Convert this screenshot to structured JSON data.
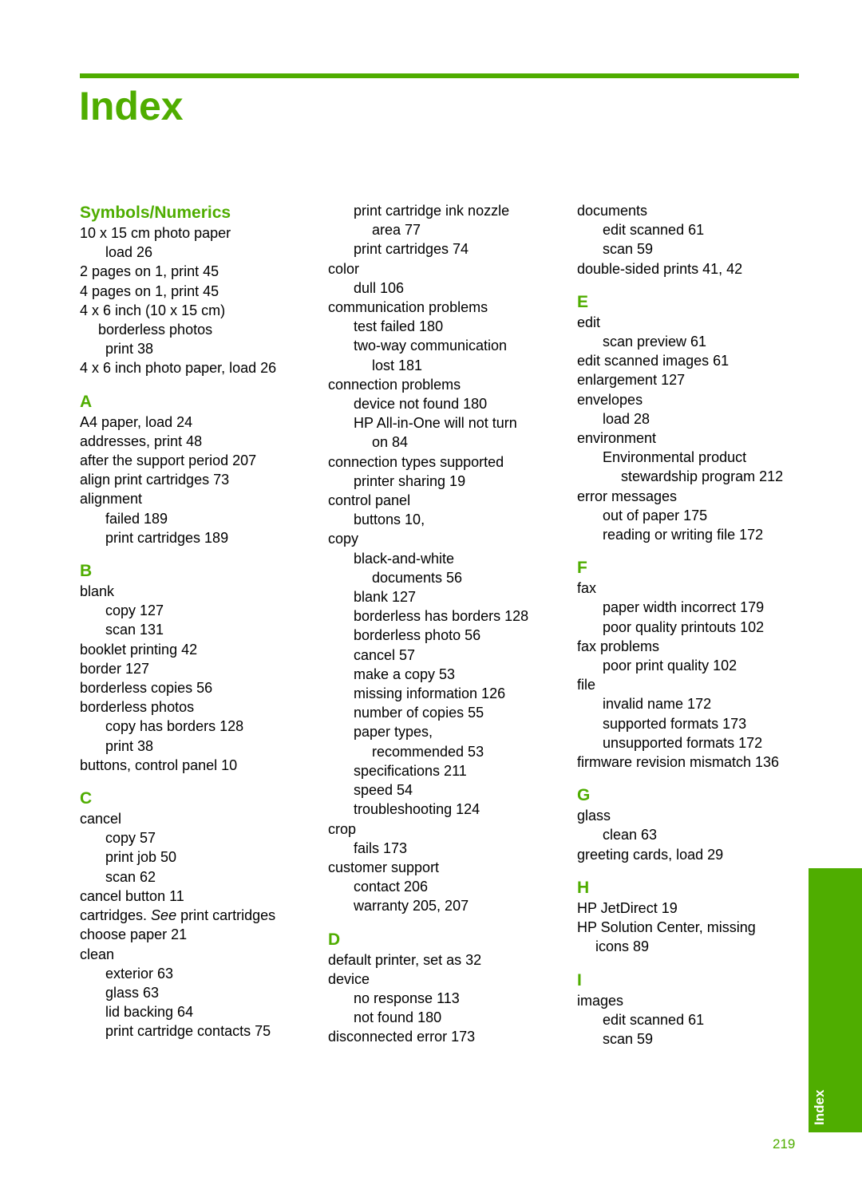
{
  "page": {
    "title": "Index",
    "side_tab_label": "Index",
    "page_number": "219",
    "accent_color": "#4fad00"
  },
  "columns": [
    {
      "sections": [
        {
          "heading": "Symbols/Numerics",
          "entries": [
            {
              "level": 0,
              "text": "10 x 15 cm photo paper"
            },
            {
              "level": 1,
              "text": "load 26"
            },
            {
              "level": 0,
              "text": "2 pages on 1, print 45"
            },
            {
              "level": 0,
              "text": "4 pages on 1, print 45"
            },
            {
              "level": 0,
              "text": "4 x 6 inch (10 x 15 cm)"
            },
            {
              "level": "wrap0",
              "text": "borderless photos"
            },
            {
              "level": 1,
              "text": "print 38"
            },
            {
              "level": 0,
              "text": "4 x 6 inch photo paper, load 26"
            }
          ]
        },
        {
          "heading": "A",
          "entries": [
            {
              "level": 0,
              "text": "A4 paper, load 24"
            },
            {
              "level": 0,
              "text": "addresses, print 48"
            },
            {
              "level": 0,
              "text": "after the support period 207"
            },
            {
              "level": 0,
              "text": "align print cartridges 73"
            },
            {
              "level": 0,
              "text": "alignment"
            },
            {
              "level": 1,
              "text": "failed 189"
            },
            {
              "level": 1,
              "text": "print cartridges 189"
            }
          ]
        },
        {
          "heading": "B",
          "entries": [
            {
              "level": 0,
              "text": "blank"
            },
            {
              "level": 1,
              "text": "copy 127"
            },
            {
              "level": 1,
              "text": "scan 131"
            },
            {
              "level": 0,
              "text": "booklet printing 42"
            },
            {
              "level": 0,
              "text": "border 127"
            },
            {
              "level": 0,
              "text": "borderless copies 56"
            },
            {
              "level": 0,
              "text": "borderless photos"
            },
            {
              "level": 1,
              "text": "copy has borders 128"
            },
            {
              "level": 1,
              "text": "print 38"
            },
            {
              "level": 0,
              "text": "buttons, control panel 10"
            }
          ]
        },
        {
          "heading": "C",
          "entries": [
            {
              "level": 0,
              "text": "cancel"
            },
            {
              "level": 1,
              "text": "copy 57"
            },
            {
              "level": 1,
              "text": "print job 50"
            },
            {
              "level": 1,
              "text": "scan 62"
            },
            {
              "level": 0,
              "text": "cancel button 11"
            },
            {
              "level": 0,
              "text": "cartridges. ",
              "see": "See",
              "see_target": " print cartridges"
            },
            {
              "level": 0,
              "text": "choose paper 21"
            },
            {
              "level": 0,
              "text": "clean"
            },
            {
              "level": 1,
              "text": "exterior 63"
            },
            {
              "level": 1,
              "text": "glass 63"
            },
            {
              "level": 1,
              "text": "lid backing 64"
            },
            {
              "level": 1,
              "text": "print cartridge contacts 75"
            }
          ]
        }
      ]
    },
    {
      "sections": [
        {
          "heading": "",
          "entries": [
            {
              "level": 1,
              "text": "print cartridge ink nozzle"
            },
            {
              "level": 2,
              "text": "area 77"
            },
            {
              "level": 1,
              "text": "print cartridges 74"
            },
            {
              "level": 0,
              "text": "color"
            },
            {
              "level": 1,
              "text": "dull 106"
            },
            {
              "level": 0,
              "text": "communication problems"
            },
            {
              "level": 1,
              "text": "test failed 180"
            },
            {
              "level": 1,
              "text": "two-way communication"
            },
            {
              "level": 2,
              "text": "lost 181"
            },
            {
              "level": 0,
              "text": "connection problems"
            },
            {
              "level": 1,
              "text": "device not found 180"
            },
            {
              "level": 1,
              "text": "HP All-in-One will not turn"
            },
            {
              "level": 2,
              "text": "on 84"
            },
            {
              "level": 0,
              "text": "connection types supported"
            },
            {
              "level": 1,
              "text": "printer sharing 19"
            },
            {
              "level": 0,
              "text": "control panel"
            },
            {
              "level": 1,
              "text": "buttons 10,"
            },
            {
              "level": 0,
              "text": "copy"
            },
            {
              "level": 1,
              "text": "black-and-white"
            },
            {
              "level": 2,
              "text": "documents 56"
            },
            {
              "level": 1,
              "text": "blank 127"
            },
            {
              "level": 1,
              "text": "borderless has borders 128"
            },
            {
              "level": 1,
              "text": "borderless photo 56"
            },
            {
              "level": 1,
              "text": "cancel 57"
            },
            {
              "level": 1,
              "text": "make a copy 53"
            },
            {
              "level": 1,
              "text": "missing information 126"
            },
            {
              "level": 1,
              "text": "number of copies 55"
            },
            {
              "level": 1,
              "text": "paper types,"
            },
            {
              "level": 2,
              "text": "recommended 53"
            },
            {
              "level": 1,
              "text": "specifications 211"
            },
            {
              "level": 1,
              "text": "speed 54"
            },
            {
              "level": 1,
              "text": "troubleshooting 124"
            },
            {
              "level": 0,
              "text": "crop"
            },
            {
              "level": 1,
              "text": "fails 173"
            },
            {
              "level": 0,
              "text": "customer support"
            },
            {
              "level": 1,
              "text": "contact 206"
            },
            {
              "level": 1,
              "text": "warranty 205, 207"
            }
          ]
        },
        {
          "heading": "D",
          "entries": [
            {
              "level": 0,
              "text": "default printer, set as 32"
            },
            {
              "level": 0,
              "text": "device"
            },
            {
              "level": 1,
              "text": "no response 113"
            },
            {
              "level": 1,
              "text": "not found 180"
            },
            {
              "level": 0,
              "text": "disconnected error 173"
            }
          ]
        }
      ]
    },
    {
      "sections": [
        {
          "heading": "",
          "entries": [
            {
              "level": 0,
              "text": "documents"
            },
            {
              "level": 1,
              "text": "edit scanned 61"
            },
            {
              "level": 1,
              "text": "scan 59"
            },
            {
              "level": 0,
              "text": "double-sided prints 41, 42"
            }
          ]
        },
        {
          "heading": "E",
          "entries": [
            {
              "level": 0,
              "text": "edit"
            },
            {
              "level": 1,
              "text": "scan preview 61"
            },
            {
              "level": 0,
              "text": "edit scanned images 61"
            },
            {
              "level": 0,
              "text": "enlargement 127"
            },
            {
              "level": 0,
              "text": "envelopes"
            },
            {
              "level": 1,
              "text": "load 28"
            },
            {
              "level": 0,
              "text": "environment"
            },
            {
              "level": 1,
              "text": "Environmental product"
            },
            {
              "level": 2,
              "text": "stewardship program 212"
            },
            {
              "level": 0,
              "text": "error messages"
            },
            {
              "level": 1,
              "text": "out of paper 175"
            },
            {
              "level": 1,
              "text": "reading or writing file 172"
            }
          ]
        },
        {
          "heading": "F",
          "entries": [
            {
              "level": 0,
              "text": "fax"
            },
            {
              "level": 1,
              "text": "paper width incorrect 179"
            },
            {
              "level": 1,
              "text": "poor quality printouts 102"
            },
            {
              "level": 0,
              "text": "fax problems"
            },
            {
              "level": 1,
              "text": "poor print quality 102"
            },
            {
              "level": 0,
              "text": "file"
            },
            {
              "level": 1,
              "text": "invalid name 172"
            },
            {
              "level": 1,
              "text": "supported formats 173"
            },
            {
              "level": 1,
              "text": "unsupported formats 172"
            },
            {
              "level": 0,
              "text": "firmware revision mismatch 136"
            }
          ]
        },
        {
          "heading": "G",
          "entries": [
            {
              "level": 0,
              "text": "glass"
            },
            {
              "level": 1,
              "text": "clean 63"
            },
            {
              "level": 0,
              "text": "greeting cards, load 29"
            }
          ]
        },
        {
          "heading": "H",
          "entries": [
            {
              "level": 0,
              "text": "HP JetDirect 19"
            },
            {
              "level": 0,
              "text": "HP Solution Center, missing"
            },
            {
              "level": "wrap0",
              "text": "icons 89"
            }
          ]
        },
        {
          "heading": "I",
          "entries": [
            {
              "level": 0,
              "text": "images"
            },
            {
              "level": 1,
              "text": "edit scanned 61"
            },
            {
              "level": 1,
              "text": "scan 59"
            }
          ]
        }
      ]
    }
  ]
}
